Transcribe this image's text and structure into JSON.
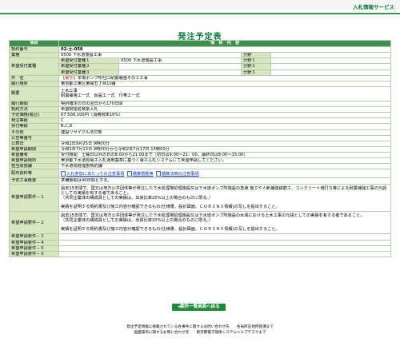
{
  "header": {
    "service_name": "入札情報サービス"
  },
  "page": {
    "title": "発注予定表"
  },
  "table": {
    "col_item": "項目",
    "col_content": "項　目　内　容",
    "contract_no_label": "契約番号",
    "contract_no": "02-土-058",
    "category_label": "業種",
    "category_value": "0500 下水道施設工事",
    "bunya_label": "分野",
    "desired_label": "希望受付業種",
    "desired": [
      {
        "label": "希望受付業種１",
        "value": "0500 下水道施設工事",
        "bunya": "分野１"
      },
      {
        "label": "希望受付業種２",
        "value": "",
        "bunya": "分野２"
      },
      {
        "label": "希望受付業種３",
        "value": "",
        "bunya": "分野３"
      }
    ],
    "name_label": "件　名",
    "name_tag": "【電子】",
    "name_value": "本場ポンプ所吐口耐震補強その２工事",
    "location_label": "履行場所",
    "location_value": "東京都江東区東陽五丁目10番",
    "summary_label": "概要",
    "summary_lines": [
      "土木工事",
      "耐震補強工一式　仮設工一式　付帯工一式"
    ],
    "period_label": "履行期間",
    "period_value": "契約確定の日の翌日から170日間",
    "method_label": "契約方法",
    "method_value": "希望制指名競争入札",
    "price_label": "予定価格(税込)",
    "price_value": "67,508,100円（消費税率10%）",
    "form_label": "発注等級",
    "form_value": "C",
    "accept_label": "受付等級",
    "accept_value": "B,C,D",
    "other_label": "その他",
    "other_value": "建設リサイクル法対象",
    "announce_label": "公告等番号",
    "announce_date_label": "公表日",
    "announce_date_value": "令和2年9月25日 9時00分",
    "apply_period_label": "希望申請期間",
    "apply_period_value": "令和2年7月13日 9時00分から令和2年7月17日 15時00分",
    "apply_remarks_label": "希望備考",
    "apply_remarks_value": "受付時間　土曜日以外の日の8:00から21:00まで（初日は9:00～21：00、最終日は8:00～15:00）",
    "apply_place_label": "希望申請場所",
    "apply_place_value": "東京都下水道局電子入札運用基準に基づく電子入札システムにて希望申請してください。",
    "dept_label": "担当局部課",
    "dept_value": "下水道局経理部契約課",
    "docs_label": "配布資料等",
    "docs_links": [
      "入札参加にあたっての注意事項",
      "積算根拠等",
      "積算法時の注意事項"
    ],
    "plan_label": "予定工事概要",
    "plan_value": "準備期間は40日間とする。",
    "req1_label": "希望申請要件－１",
    "req1_para1": "過去15年間で、国又は地方公共団体等が発注した下水処理場処理施設又は下水道ポンプ所施設の急速 施工や人断補強鉄筋工、コンクリート増打ち等による耐震補強工事の元請としての実績を有する者であること。",
    "req1_para2": "（共同企業体の構成員としての実績は、出資比率20%以上の場合のものに限る。）",
    "req1_para3": "実績を証明する契約書及び施工内容が確認できるもの(仕様書、設計図面、ＣＯＲＩＮＳ情報)の写しを提出すること。",
    "req2_label": "希望申請要件－２",
    "req2_para1": "過去15年間で、国又は地方公共団体等が発注した下水処理場処理施設又は下水道ポンプ所施設の水域における土木工事の元請としての実績を有する者であること。",
    "req2_para2": "（共同企業体の構成員としての実績は、出資比率20%以上の場合のものに限る。）",
    "req2_para3": "実績を証明する契約書及び施工内容が確認できるもの(仕様書、設計図面、ＣＯＲＩＮＳ情報)の写しを提出すること。",
    "req_empty": [
      "希望申請要件－３",
      "希望申請要件－４",
      "希望申請要件－５",
      "希望申請要件－６"
    ]
  },
  "button": {
    "back_label": "◂案件一覧画面へ戻る"
  },
  "footer": {
    "line1": "発注予定情報に掲載されている各事件に関するお問い合わせ先　　各局所在地所管課まで",
    "line2": "画面操作に関するお問い合わせ先　　東京都電子調達システムヘルプデスクまで"
  }
}
